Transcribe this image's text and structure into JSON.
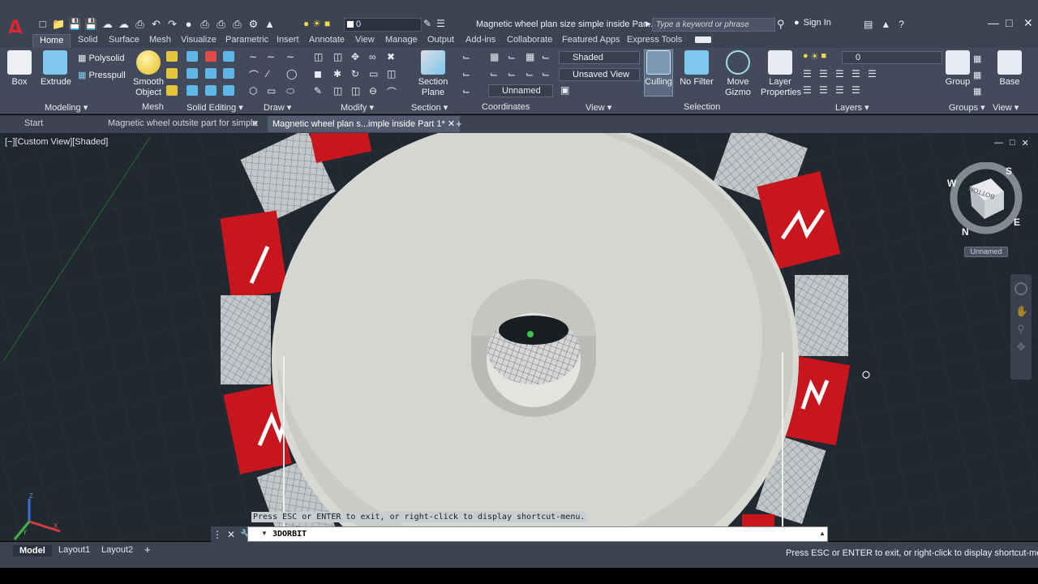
{
  "titlebar": {
    "layer_value": "0",
    "document_title": "Magnetic wheel plan size simple inside Par...",
    "search_placeholder": "Type a keyword or phrase",
    "signin": "Sign In"
  },
  "ribbon_tabs": [
    "Home",
    "Solid",
    "Surface",
    "Mesh",
    "Visualize",
    "Parametric",
    "Insert",
    "Annotate",
    "View",
    "Manage",
    "Output",
    "Add-ins",
    "Collaborate",
    "Featured Apps",
    "Express Tools"
  ],
  "ribbon": {
    "box": "Box",
    "extrude": "Extrude",
    "polysolid": "Polysolid",
    "presspull": "Presspull",
    "smooth_object_1": "Smooth",
    "smooth_object_2": "Object",
    "section_plane_1": "Section",
    "section_plane_2": "Plane",
    "visual_style": "Shaded",
    "view_name": "Unsaved View",
    "ucs_name": "Unnamed",
    "culling": "Culling",
    "no_filter": "No Filter",
    "move_gizmo_1": "Move",
    "move_gizmo_2": "Gizmo",
    "layer_props_1": "Layer",
    "layer_props_2": "Properties",
    "layer_value": "0",
    "group": "Group",
    "base": "Base",
    "panels": {
      "modeling": "Modeling",
      "mesh": "Mesh",
      "solid_editing": "Solid Editing",
      "draw": "Draw",
      "modify": "Modify",
      "section": "Section",
      "coordinates": "Coordinates",
      "view": "View",
      "selection": "Selection",
      "layers": "Layers",
      "groups": "Groups",
      "view2": "View"
    }
  },
  "doc_tabs": {
    "start": "Start",
    "tab1": "Magnetic wheel outsite part for simple",
    "tab2": "Magnetic wheel plan s...imple inside Part 1*"
  },
  "viewport": {
    "label": "[−][Custom View][Shaded]",
    "viewcube_face": "BOTTOM",
    "compass": {
      "n": "N",
      "s": "S",
      "e": "E",
      "w": "W"
    },
    "ucs_label": "Unnamed",
    "axes": {
      "z": "Z",
      "x": "X",
      "y": "Y"
    }
  },
  "command": {
    "hint": "Press ESC or ENTER to exit, or right-click to display shortcut-menu.",
    "current": "3DORBIT"
  },
  "layout_tabs": [
    "Model",
    "Layout1",
    "Layout2"
  ],
  "status": "Press ESC or ENTER to exit, or right-click to display shortcut-menu.",
  "colors": {
    "accent_red": "#c7161e",
    "titlebar": "#3b4453",
    "viewport": "#212830"
  }
}
